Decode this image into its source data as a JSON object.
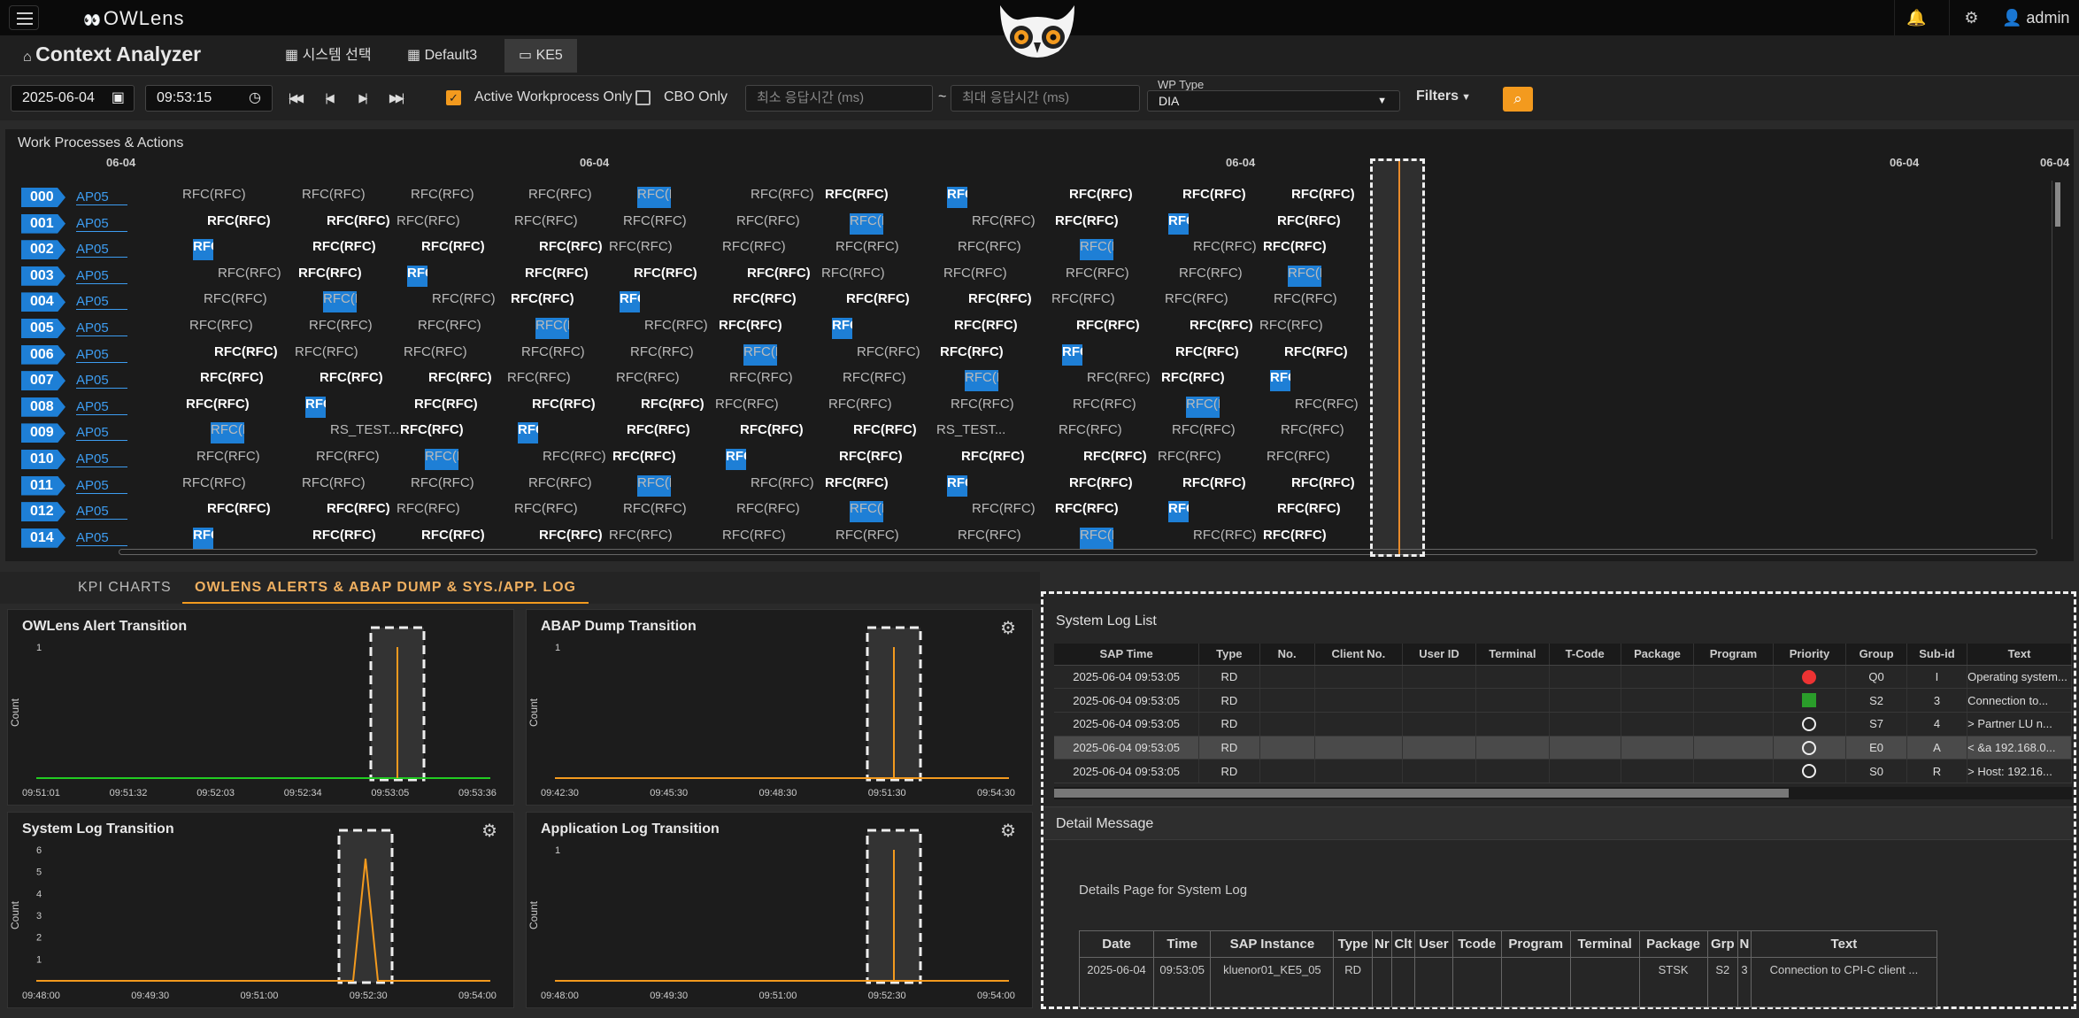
{
  "header": {
    "brand": "OWLens",
    "user": "admin",
    "icons": [
      "menu-icon",
      "bell-icon",
      "settings-icon",
      "user-icon"
    ]
  },
  "context": {
    "title": "Context Analyzer",
    "tabs": [
      {
        "label": "시스템 선택",
        "icon": "grid-icon"
      },
      {
        "label": "Default3",
        "icon": "grid-icon"
      },
      {
        "label": "KE5",
        "icon": "monitor-icon"
      }
    ]
  },
  "toolbar": {
    "date": "2025-06-04",
    "time": "09:53:15",
    "active_only_label": "Active Workprocess Only",
    "active_only_checked": true,
    "cbo_label": "CBO Only",
    "cbo_checked": false,
    "min_placeholder": "최소 응답시간 (ms)",
    "tilde": "~",
    "max_placeholder": "최대 응답시간 (ms)",
    "wp_type_label": "WP Type",
    "wp_type_value": "DIA",
    "filters_label": "Filters"
  },
  "wp_panel": {
    "title": "Work Processes & Actions",
    "axis_labels": [
      "06-04",
      "06-04",
      "06-04",
      "06-04",
      "06-04"
    ],
    "instance": "AP05",
    "action_label": "RFC(RFC)",
    "special_label": "RS_TEST...",
    "rows": [
      "000",
      "001",
      "002",
      "003",
      "004",
      "005",
      "006",
      "007",
      "008",
      "009",
      "010",
      "011",
      "012",
      "014"
    ]
  },
  "lower_tabs": [
    "KPI CHARTS",
    "OWLENS ALERTS & ABAP DUMP & SYS./APP. LOG"
  ],
  "charts": [
    {
      "title": "OWLens Alert Transition",
      "ylabel": "Count",
      "yticks": [
        "1"
      ],
      "xticks": [
        "09:51:01",
        "09:51:32",
        "09:52:03",
        "09:52:34",
        "09:53:05",
        "09:53:36"
      ],
      "line_color": "#22cc22",
      "peak": null,
      "gear": false
    },
    {
      "title": "ABAP Dump Transition",
      "ylabel": "Count",
      "yticks": [
        "1"
      ],
      "xticks": [
        "09:42:30",
        "09:45:30",
        "09:48:30",
        "09:51:30",
        "09:54:30"
      ],
      "line_color": "#f39a1e",
      "peak": null,
      "gear": true
    },
    {
      "title": "System Log Transition",
      "ylabel": "Count",
      "yticks": [
        "6",
        "5",
        "4",
        "3",
        "2",
        "1"
      ],
      "xticks": [
        "09:48:00",
        "09:49:30",
        "09:51:00",
        "09:52:30",
        "09:54:00"
      ],
      "line_color": "#f39a1e",
      "peak": 6,
      "gear": true
    },
    {
      "title": "Application Log Transition",
      "ylabel": "Count",
      "yticks": [
        "1"
      ],
      "xticks": [
        "09:48:00",
        "09:49:30",
        "09:51:00",
        "09:52:30",
        "09:54:00"
      ],
      "line_color": "#f39a1e",
      "peak": null,
      "gear": true
    }
  ],
  "system_log": {
    "title": "System Log List",
    "columns": [
      "SAP Time",
      "Type",
      "No.",
      "Client No.",
      "User ID",
      "Terminal",
      "T-Code",
      "Package",
      "Program",
      "Priority",
      "Group",
      "Sub-id",
      "Text"
    ],
    "rows": [
      {
        "time": "2025-06-04 09:53:05",
        "type": "RD",
        "priority": "red",
        "group": "Q0",
        "subid": "I",
        "text": "Operating system..."
      },
      {
        "time": "2025-06-04 09:53:05",
        "type": "RD",
        "priority": "green",
        "group": "S2",
        "subid": "3",
        "text": "Connection to..."
      },
      {
        "time": "2025-06-04 09:53:05",
        "type": "RD",
        "priority": "ring",
        "group": "S7",
        "subid": "4",
        "text": "> Partner LU n..."
      },
      {
        "time": "2025-06-04 09:53:05",
        "type": "RD",
        "priority": "ring",
        "group": "E0",
        "subid": "A",
        "text": "< &a 192.168.0..."
      },
      {
        "time": "2025-06-04 09:53:05",
        "type": "RD",
        "priority": "ring",
        "group": "S0",
        "subid": "R",
        "text": "> Host: 192.16..."
      }
    ]
  },
  "detail": {
    "title": "Detail Message",
    "caption": "Details Page for System Log",
    "columns": [
      "Date",
      "Time",
      "SAP Instance",
      "Type",
      "Nr",
      "Clt",
      "User",
      "Tcode",
      "Program",
      "Terminal",
      "Package",
      "Grp",
      "N",
      "Text"
    ],
    "row": {
      "date": "2025-06-04",
      "time": "09:53:05",
      "instance": "kluenor01_KE5_05",
      "type": "RD",
      "package": "STSK",
      "grp": "S2",
      "n": "3",
      "text": "Connection to CPI-C client ..."
    }
  }
}
